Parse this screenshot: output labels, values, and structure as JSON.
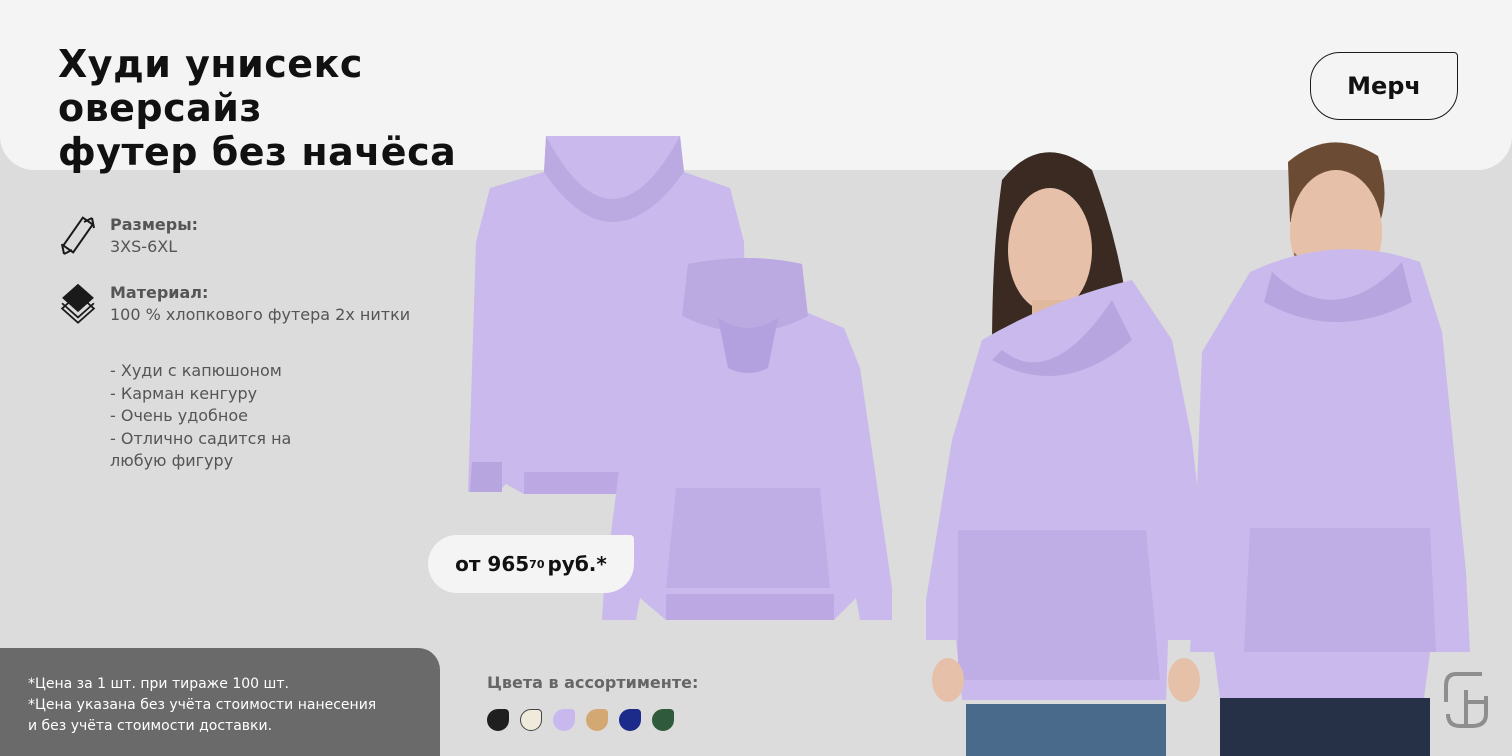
{
  "header": {
    "title_line1": "Худи унисекс оверсайз",
    "title_line2": "футер без начёса",
    "merch_label": "Мерч"
  },
  "specs": {
    "sizes_label": "Размеры:",
    "sizes_value": "3XS-6XL",
    "material_label": "Материал:",
    "material_value": "100 % хлопкового футера 2х нитки"
  },
  "features": [
    "- Худи с капюшоном",
    "- Карман кенгуру",
    "- Очень удобное",
    "- Отлично садится на",
    "любую фигуру"
  ],
  "price": {
    "prefix": "от 965",
    "kopecks": "70",
    "suffix": "руб.*"
  },
  "notes": {
    "line1": "*Цена за 1 шт. при тираже 100 шт.",
    "line2": "*Цена указана без учёта стоимости нанесения",
    "line3": "и без учёта стоимости доставки."
  },
  "colors": {
    "label": "Цвета в ассортименте:",
    "swatches": [
      "#1f1f1f",
      "#efeadc",
      "#c8b8ee",
      "#d4a873",
      "#1c2a8a",
      "#2f5a3c"
    ]
  },
  "icons": {
    "sizes": "ruler-icon",
    "material": "layers-icon",
    "logo": "brand-logo-icon"
  },
  "theme": {
    "hoodie_color": "#c9b9ec",
    "hoodie_shade": "#b7a5e0"
  }
}
